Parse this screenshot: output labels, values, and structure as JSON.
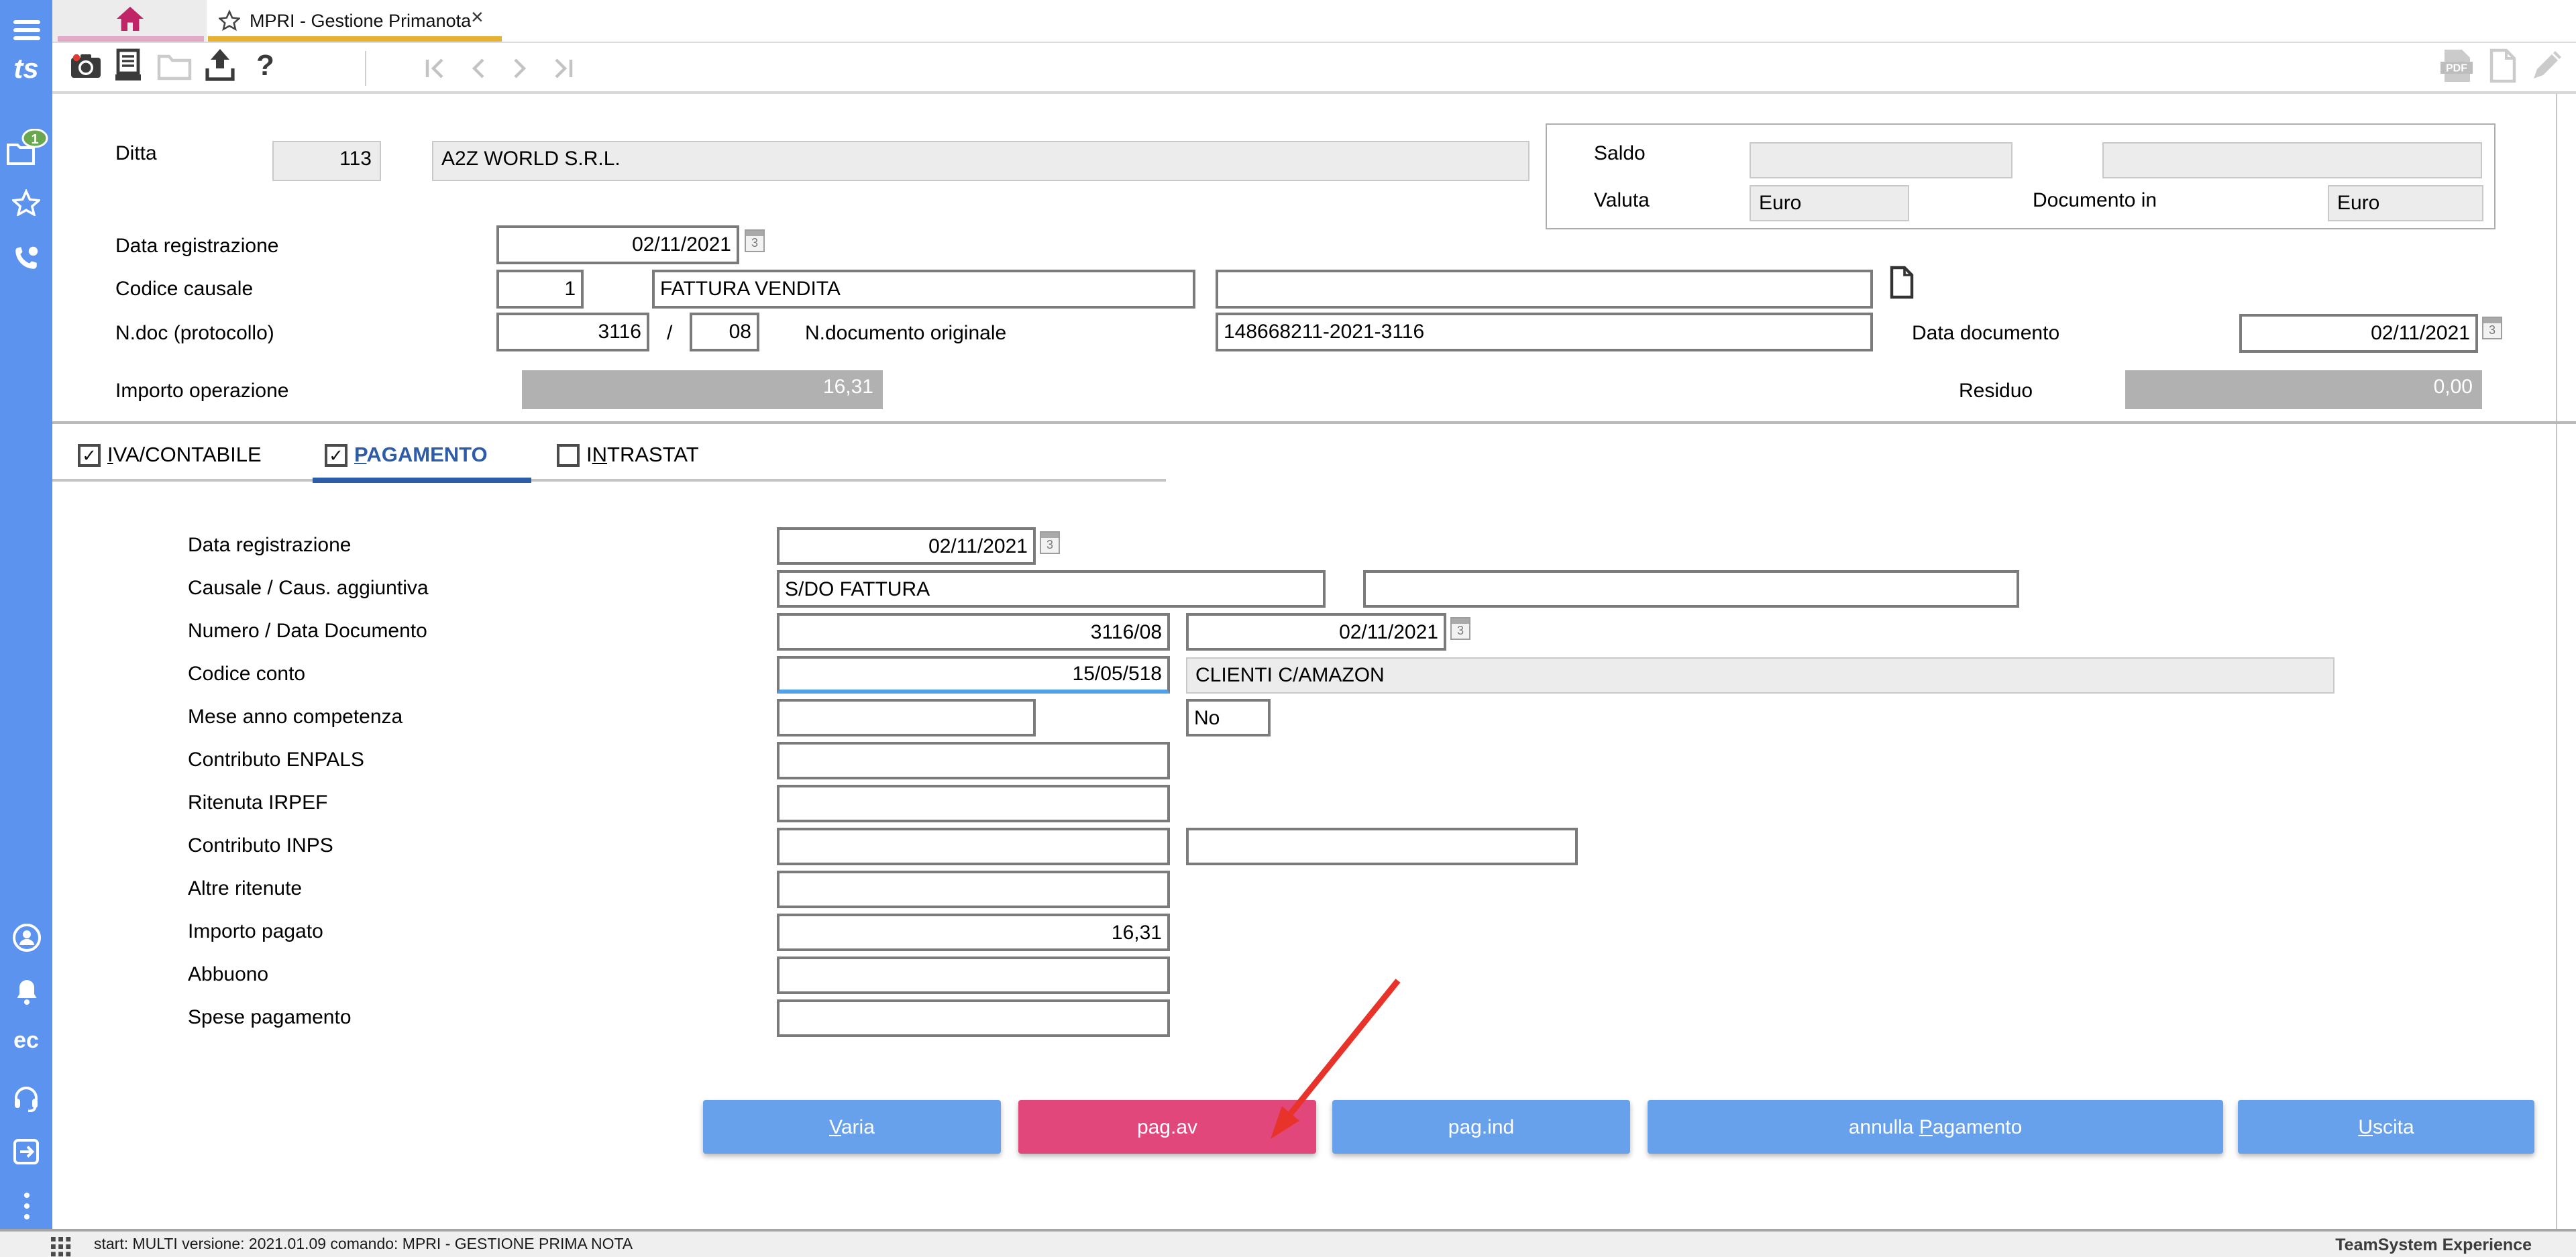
{
  "window": {
    "tab_title": "MPRI - Gestione Primanota",
    "close_glyph": "×",
    "status_text": "start: MULTI versione: 2021.01.09 comando: MPRI - GESTIONE PRIMA NOTA",
    "brand": "TeamSystem Experience"
  },
  "icons": {
    "calendar_day": "3",
    "help_glyph": "?",
    "pdf_label": "PDF",
    "ts_logo": "ts",
    "ec_logo": "ec",
    "badge_count": "1"
  },
  "colors": {
    "sidebar_blue": "#5b93ef",
    "button_blue": "#67a0eb",
    "button_pink": "#e2477b",
    "active_tab_blue": "#2d5ca8",
    "home_tab_pink": "#c02568",
    "doc_tab_gold": "#e6b231"
  },
  "header": {
    "ditta_label": "Ditta",
    "ditta_code": "113",
    "ditta_name": "A2Z WORLD S.R.L.",
    "saldo_label": "Saldo",
    "valuta_label": "Valuta",
    "valuta_value": "Euro",
    "documento_in_label": "Documento in",
    "documento_in_value": "Euro",
    "data_registrazione_label": "Data registrazione",
    "data_registrazione_value": "02/11/2021",
    "codice_causale_label": "Codice causale",
    "codice_causale_code": "1",
    "codice_causale_desc": "FATTURA VENDITA",
    "codice_causale_extra": "",
    "ndoc_label": "N.doc (protocollo)",
    "ndoc_value": "3116",
    "ndoc_separator": "/",
    "protocollo_value": "08",
    "ndoc_originale_label": "N.documento originale",
    "ndoc_originale_value": "148668211-2021-3116",
    "data_documento_label": "Data documento",
    "data_documento_value": "02/11/2021",
    "importo_operazione_label": "Importo operazione",
    "importo_operazione_value": "16,31",
    "residuo_label": "Residuo",
    "residuo_value": "0,00",
    "saldo_value1": "",
    "saldo_value2": ""
  },
  "tabs": [
    {
      "pre": "",
      "key": "I",
      "post": "VA/CONTABILE",
      "check": "✓"
    },
    {
      "pre": "",
      "key": "P",
      "post": "AGAMENTO",
      "check": "✓"
    },
    {
      "pre": "I",
      "key": "N",
      "post": "TRASTAT",
      "check": ""
    }
  ],
  "payment": {
    "rows": [
      {
        "label": "Data registrazione",
        "value": "02/11/2021"
      },
      {
        "label": "Causale / Caus. aggiuntiva",
        "value": "S/DO FATTURA",
        "value2": ""
      },
      {
        "label": "Numero / Data Documento",
        "value": "3116/08",
        "value2": "02/11/2021"
      },
      {
        "label": "Codice conto",
        "value": "15/05/518",
        "desc": "CLIENTI C/AMAZON"
      },
      {
        "label": "Mese anno competenza",
        "value": "",
        "flag": "No"
      },
      {
        "label": "Contributo ENPALS",
        "value": ""
      },
      {
        "label": "Ritenuta IRPEF",
        "value": ""
      },
      {
        "label": "Contributo INPS",
        "value": "",
        "value2": ""
      },
      {
        "label": "Altre ritenute",
        "value": ""
      },
      {
        "label": "Importo pagato",
        "value": "16,31"
      },
      {
        "label": "Abbuono",
        "value": ""
      },
      {
        "label": "Spese pagamento",
        "value": ""
      }
    ]
  },
  "buttons": [
    {
      "pre": "",
      "key": "V",
      "post": "aria"
    },
    {
      "label": "pag.av"
    },
    {
      "label": "pag.ind"
    },
    {
      "pre": "annulla ",
      "key": "P",
      "post": "agamento"
    },
    {
      "pre": "",
      "key": "U",
      "post": "scita"
    }
  ]
}
